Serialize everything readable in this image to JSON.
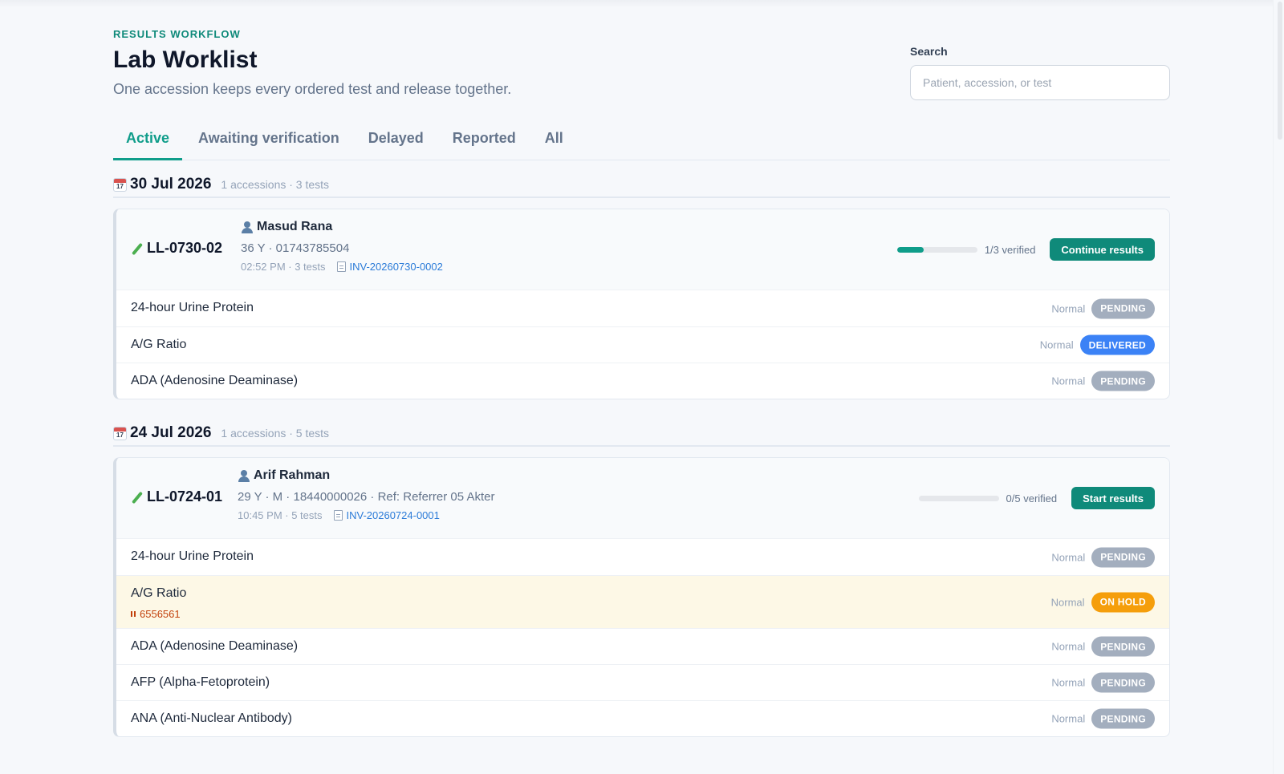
{
  "header": {
    "eyebrow": "RESULTS WORKFLOW",
    "title": "Lab Worklist",
    "subtitle": "One accession keeps every ordered test and release together."
  },
  "search": {
    "label": "Search",
    "placeholder": "Patient, accession, or test",
    "value": ""
  },
  "tabs": [
    {
      "label": "Active",
      "active": true
    },
    {
      "label": "Awaiting verification",
      "active": false
    },
    {
      "label": "Delayed",
      "active": false
    },
    {
      "label": "Reported",
      "active": false
    },
    {
      "label": "All",
      "active": false
    }
  ],
  "groups": [
    {
      "date": "30 Jul 2026",
      "meta": "1 accessions · 3 tests",
      "accession": {
        "id": "LL-0730-02",
        "patient_name": "Masud Rana",
        "patient_detail": "36 Y · 01743785504",
        "time_tests": "02:52 PM · 3 tests",
        "invoice": "INV-20260730-0002",
        "progress_fraction": 0.33,
        "verified_text": "1/3 verified",
        "action_label": "Continue results",
        "tests": [
          {
            "name": "24-hour Urine Protein",
            "flag": "Normal",
            "status": "PENDING",
            "status_type": "pending"
          },
          {
            "name": "A/G Ratio",
            "flag": "Normal",
            "status": "DELIVERED",
            "status_type": "delivered"
          },
          {
            "name": "ADA (Adenosine Deaminase)",
            "flag": "Normal",
            "status": "PENDING",
            "status_type": "pending"
          }
        ]
      }
    },
    {
      "date": "24 Jul 2026",
      "meta": "1 accessions · 5 tests",
      "accession": {
        "id": "LL-0724-01",
        "patient_name": "Arif Rahman",
        "patient_detail": "29 Y · M · 18440000026 · Ref: Referrer 05 Akter",
        "time_tests": "10:45 PM · 5 tests",
        "invoice": "INV-20260724-0001",
        "progress_fraction": 0,
        "verified_text": "0/5 verified",
        "action_label": "Start results",
        "tests": [
          {
            "name": "24-hour Urine Protein",
            "flag": "Normal",
            "status": "PENDING",
            "status_type": "pending"
          },
          {
            "name": "A/G Ratio",
            "flag": "Normal",
            "status": "ON HOLD",
            "status_type": "hold",
            "hold_note": "6556561"
          },
          {
            "name": "ADA (Adenosine Deaminase)",
            "flag": "Normal",
            "status": "PENDING",
            "status_type": "pending"
          },
          {
            "name": "AFP (Alpha-Fetoprotein)",
            "flag": "Normal",
            "status": "PENDING",
            "status_type": "pending"
          },
          {
            "name": "ANA (Anti-Nuclear Antibody)",
            "flag": "Normal",
            "status": "PENDING",
            "status_type": "pending"
          }
        ]
      }
    }
  ]
}
